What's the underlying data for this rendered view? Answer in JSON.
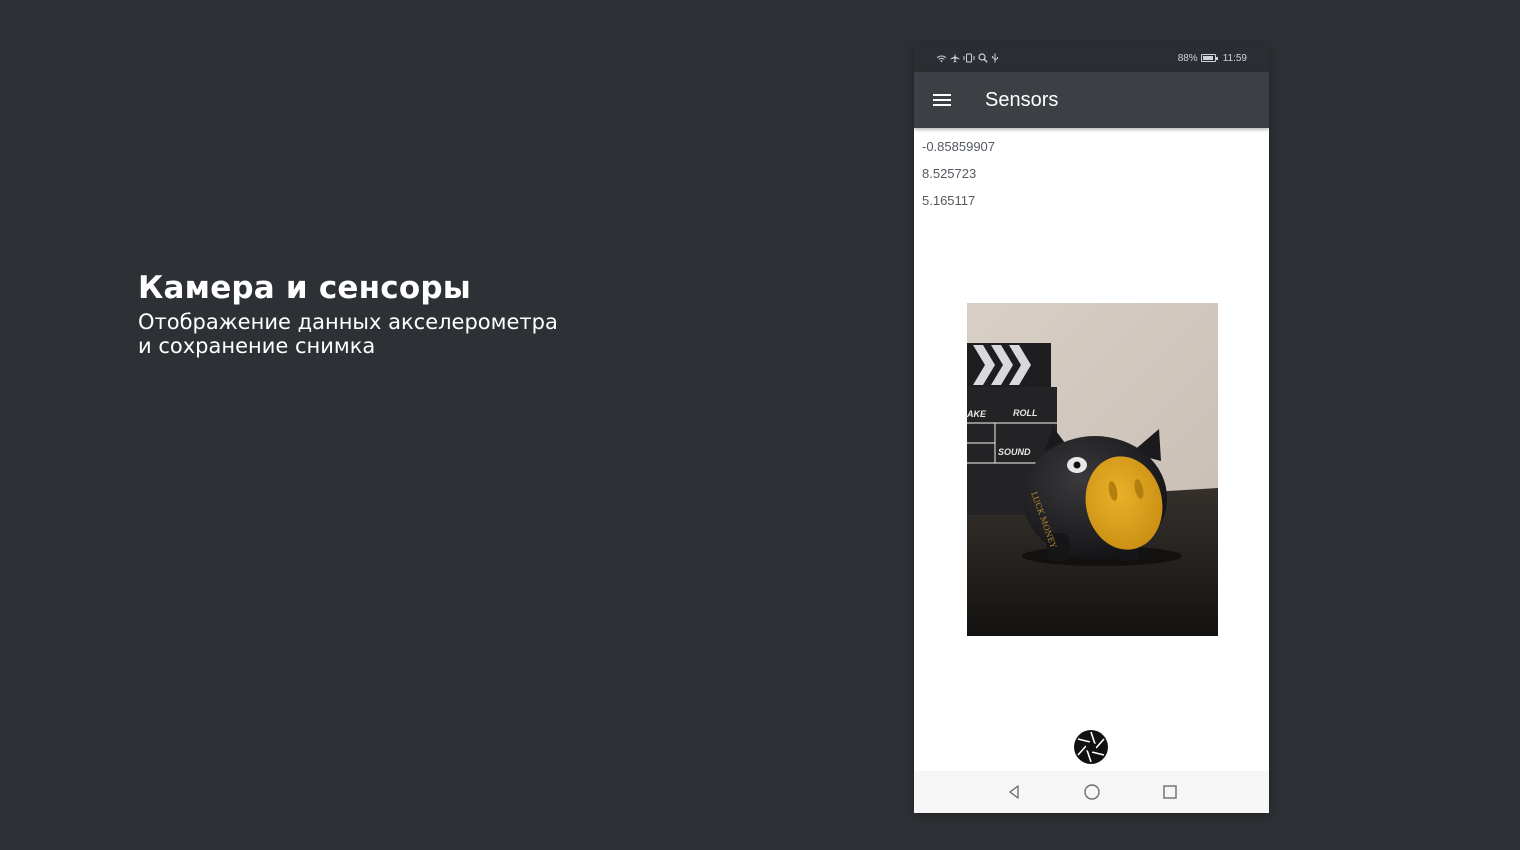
{
  "slide": {
    "title": "Камера и сенсоры",
    "subtitle": "Отображение данных акселерометра\nи сохранение снимка"
  },
  "status_bar": {
    "battery_percent": "88%",
    "battery_level": 0.88,
    "time": "11:59",
    "icons": [
      "wifi-icon",
      "airplane-icon",
      "vibrate-icon",
      "search-icon",
      "usb-icon",
      "battery-icon"
    ]
  },
  "app_bar": {
    "title": "Sensors",
    "menu_icon": "hamburger-menu-icon"
  },
  "accelerometer": {
    "x": "-0.85859907",
    "y": "8.525723",
    "z": "5.165117"
  },
  "photo": {
    "clapperboard_labels": [
      "AKE",
      "ROLL",
      "SOUND"
    ],
    "piggy_bank_text": "LUCK MONEY"
  },
  "shutter_button": {
    "icon": "camera-aperture-icon"
  },
  "nav_bar": {
    "icons": [
      "back-icon",
      "home-icon",
      "recents-icon"
    ]
  },
  "colors": {
    "background": "#2d3135",
    "app_bar": "#3c4045",
    "status_bar": "#2a2d31",
    "snout": "#e4a91a"
  }
}
